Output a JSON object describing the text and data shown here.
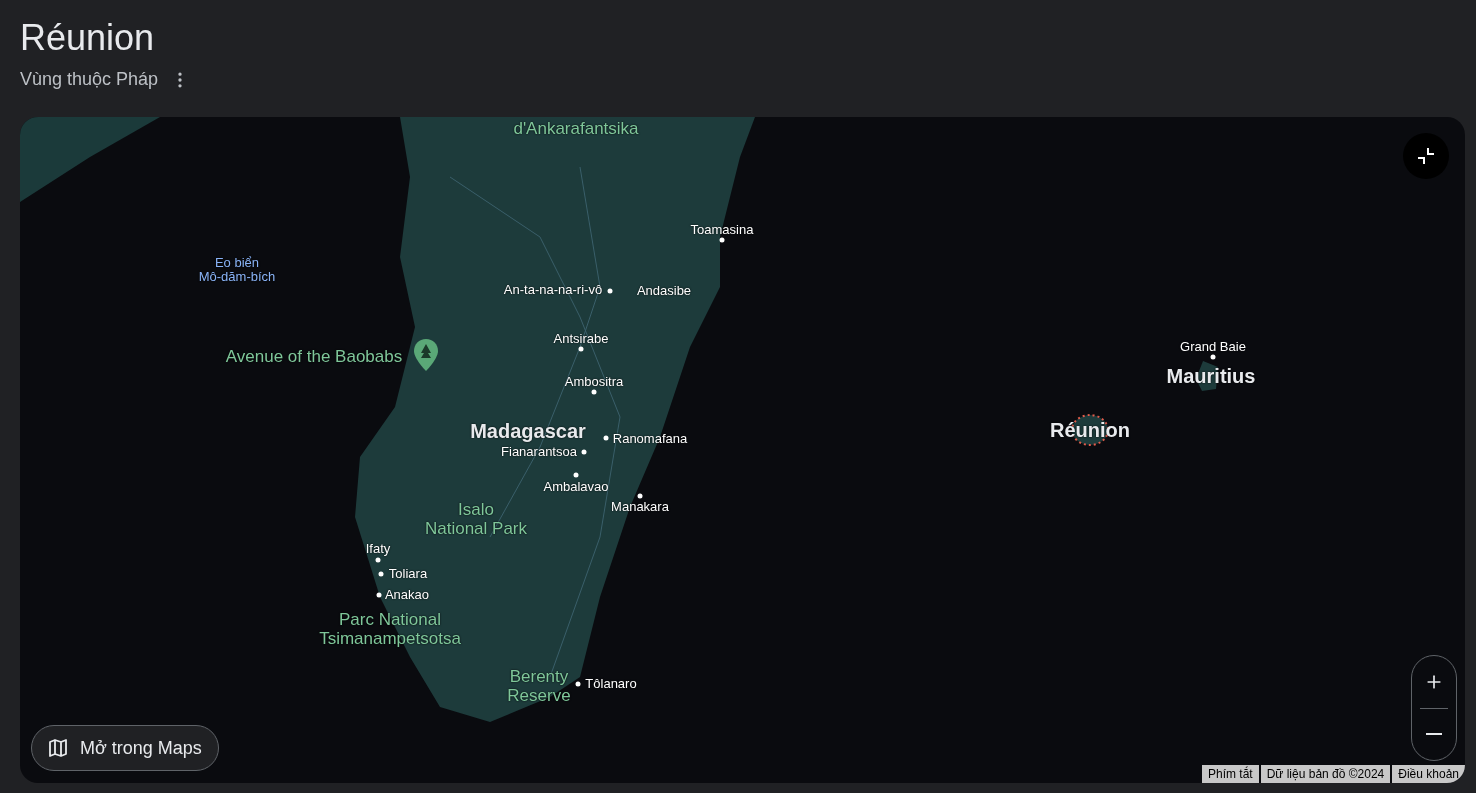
{
  "place": {
    "title": "Réunion",
    "subtitle": "Vùng thuộc Pháp"
  },
  "map": {
    "labels": [
      {
        "kind": "park",
        "text": "d'Ankarafantsika"
      },
      {
        "kind": "place",
        "text": "Toamasina"
      },
      {
        "kind": "water",
        "text": "Eo biển\nMô-dăm-bích"
      },
      {
        "kind": "place",
        "text": "An-ta-na-na-ri-vô"
      },
      {
        "kind": "place",
        "text": "Andasibe"
      },
      {
        "kind": "park",
        "text": "Avenue of the Baobabs"
      },
      {
        "kind": "place",
        "text": "Antsirabe"
      },
      {
        "kind": "place",
        "text": "Ambositra"
      },
      {
        "kind": "region",
        "text": "Madagascar"
      },
      {
        "kind": "place",
        "text": "Ranomafana"
      },
      {
        "kind": "place",
        "text": "Fianarantsoa"
      },
      {
        "kind": "place",
        "text": "Ambalavao"
      },
      {
        "kind": "place",
        "text": "Manakara"
      },
      {
        "kind": "park",
        "text": "Isalo\nNational Park"
      },
      {
        "kind": "place",
        "text": "Ifaty"
      },
      {
        "kind": "place",
        "text": "Toliara"
      },
      {
        "kind": "place",
        "text": "Anakao"
      },
      {
        "kind": "park",
        "text": "Parc National\nTsimanampetsotsa"
      },
      {
        "kind": "park",
        "text": "Berenty\nReserve"
      },
      {
        "kind": "place",
        "text": "Tôlanaro"
      },
      {
        "kind": "place",
        "text": "Grand Baie"
      },
      {
        "kind": "region",
        "text": "Mauritius"
      },
      {
        "kind": "region",
        "text": "Réunion"
      }
    ],
    "open_button": "Mở trong Maps",
    "attribution": [
      "Phím tắt",
      "Dữ liệu bản đồ ©2024",
      "Điều khoản"
    ]
  }
}
